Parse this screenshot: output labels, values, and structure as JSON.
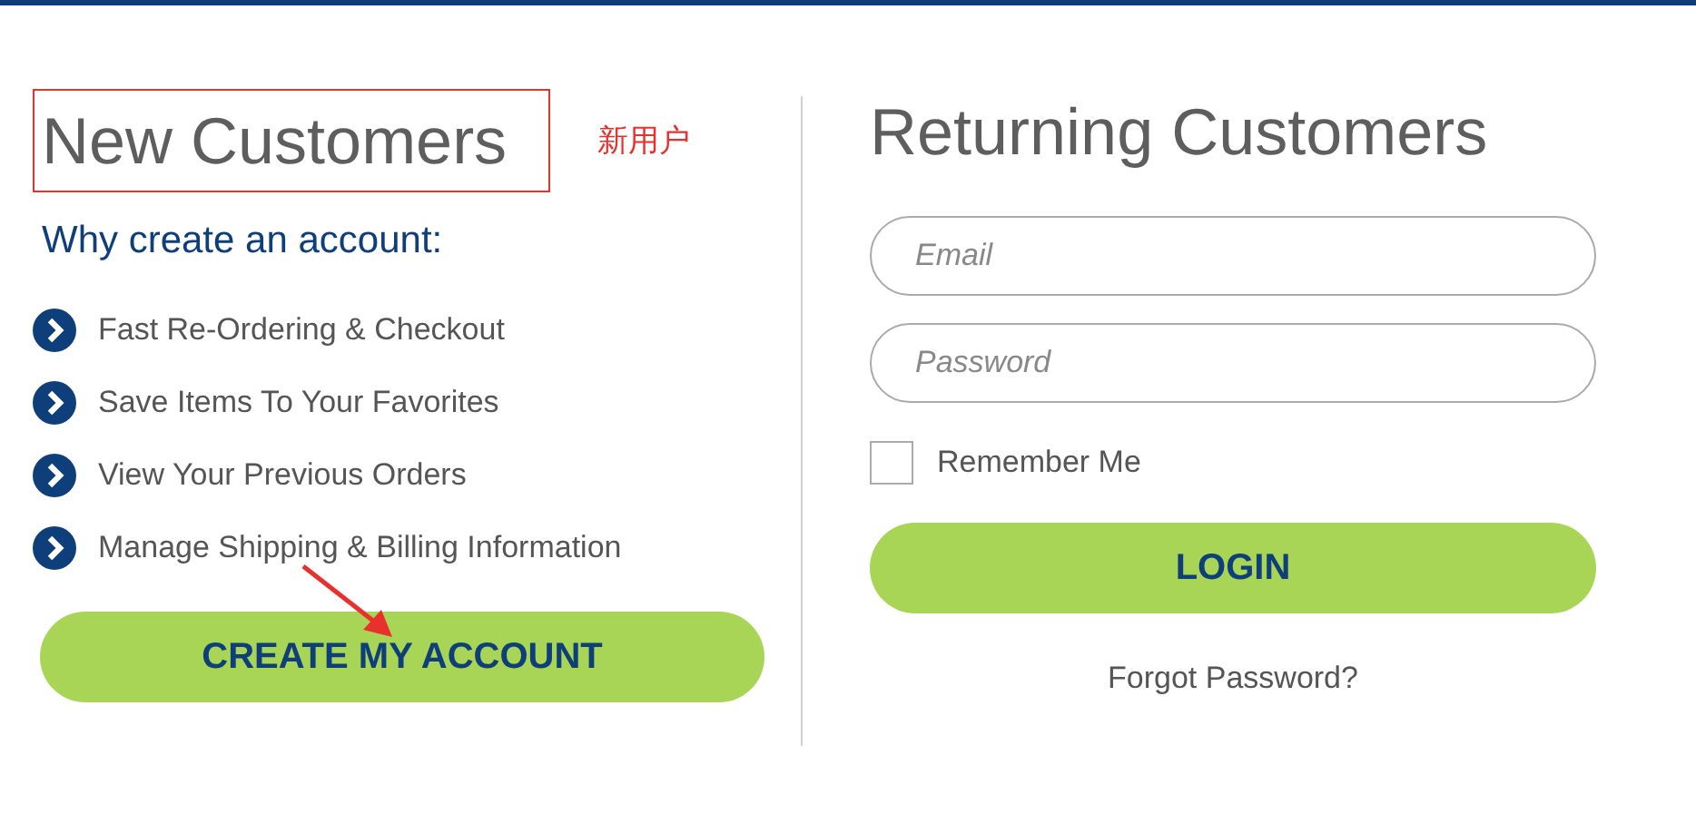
{
  "new_customers": {
    "title": "New Customers",
    "annotation_note": "新用户",
    "subtitle": "Why create an account:",
    "benefits": [
      "Fast Re-Ordering & Checkout",
      "Save Items To Your Favorites",
      "View Your Previous Orders",
      "Manage Shipping & Billing Information"
    ],
    "button": "CREATE MY ACCOUNT"
  },
  "returning_customers": {
    "title": "Returning Customers",
    "fields": [
      {
        "placeholder": "Email"
      },
      {
        "placeholder": "Password"
      }
    ],
    "remember_me": {
      "label": "Remember Me",
      "checked": false
    },
    "button": "LOGIN",
    "forgot_link": "Forgot Password?"
  }
}
